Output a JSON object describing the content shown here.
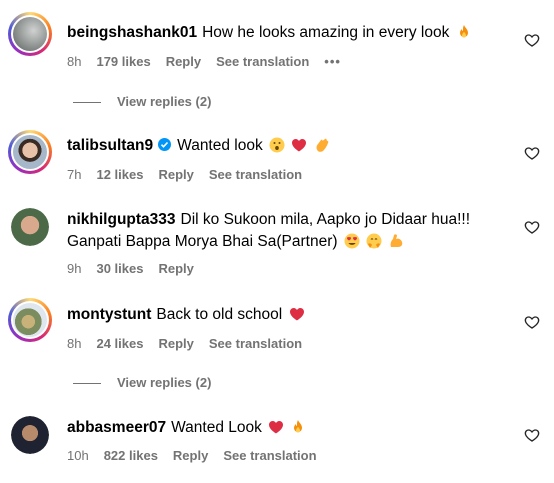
{
  "comments": [
    {
      "username": "beingshashank01",
      "text": "How he looks amazing in every look",
      "time": "8h",
      "likes": "179 likes",
      "reply": "Reply",
      "see_translation": "See translation",
      "more": "•••",
      "view_replies": "View replies (2)"
    },
    {
      "username": "talibsultan9",
      "text": "Wanted look",
      "time": "7h",
      "likes": "12 likes",
      "reply": "Reply",
      "see_translation": "See translation"
    },
    {
      "username": "nikhilgupta333",
      "text": "Dil ko Sukoon mila, Aapko jo Didaar hua!!!",
      "text2": "Ganpati Bappa Morya Bhai Sa(Partner)",
      "time": "9h",
      "likes": "30 likes",
      "reply": "Reply"
    },
    {
      "username": "montystunt",
      "text": "Back to old school",
      "time": "8h",
      "likes": "24 likes",
      "reply": "Reply",
      "see_translation": "See translation",
      "view_replies": "View replies (2)"
    },
    {
      "username": "abbasmeer07",
      "text": "Wanted Look",
      "time": "10h",
      "likes": "822 likes",
      "reply": "Reply",
      "see_translation": "See translation"
    }
  ],
  "icons": {
    "like": "heart-outline-icon",
    "verified": "verified-badge-icon"
  },
  "colors": {
    "meta": "#737373",
    "verified": "#0095f6",
    "heart": "#ed4956"
  }
}
